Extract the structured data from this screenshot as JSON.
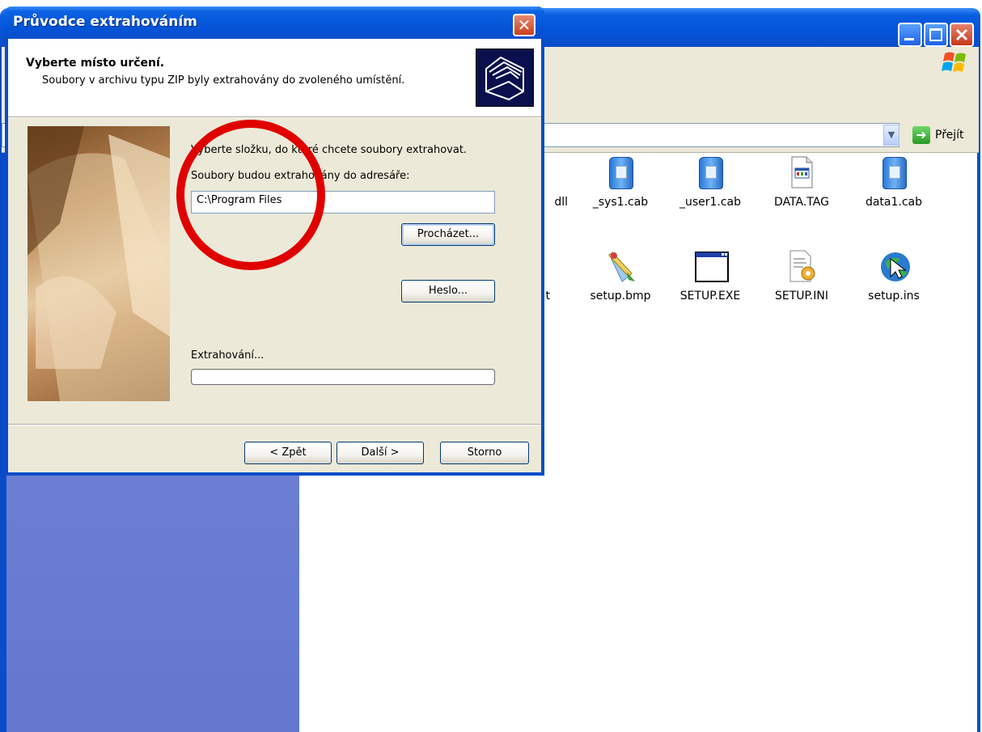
{
  "explorer": {
    "go_label": "Přejít",
    "files_row1": [
      {
        "label": "dll",
        "icon": "dll-icon"
      },
      {
        "label": "_sys1.cab",
        "icon": "cab-icon"
      },
      {
        "label": "_user1.cab",
        "icon": "cab-icon"
      },
      {
        "label": "DATA.TAG",
        "icon": "tag-file-icon"
      },
      {
        "label": "data1.cab",
        "icon": "cab-icon"
      }
    ],
    "files_row2": [
      {
        "label": "t",
        "icon": "file-icon"
      },
      {
        "label": "setup.bmp",
        "icon": "paint-bitmap-icon"
      },
      {
        "label": "SETUP.EXE",
        "icon": "exe-window-icon"
      },
      {
        "label": "SETUP.INI",
        "icon": "ini-settings-icon"
      },
      {
        "label": "setup.ins",
        "icon": "installshield-script-icon"
      }
    ]
  },
  "dialog": {
    "title": "Průvodce extrahováním",
    "close_glyph": "✕",
    "header_title": "Vyberte místo určení.",
    "header_subtitle": "Soubory v archivu typu ZIP byly extrahovány do zvoleného umístění.",
    "instruction": "Vyberte složku, do které chcete soubory extrahovat.",
    "folder_label": "Soubory budou extrahovány do adresáře:",
    "folder_value": "C:\\Program Files",
    "browse_button": "Procházet...",
    "password_button": "Heslo...",
    "progress_label": "Extrahování...",
    "progress_value": 0,
    "back_button": "< Zpět",
    "next_button": "Další >",
    "cancel_button": "Storno"
  },
  "colors": {
    "xp_blue": "#0a4cc8",
    "dialog_face": "#ece9d8",
    "annotation_red": "#e00000",
    "side_pane": "#6c7fd4"
  }
}
